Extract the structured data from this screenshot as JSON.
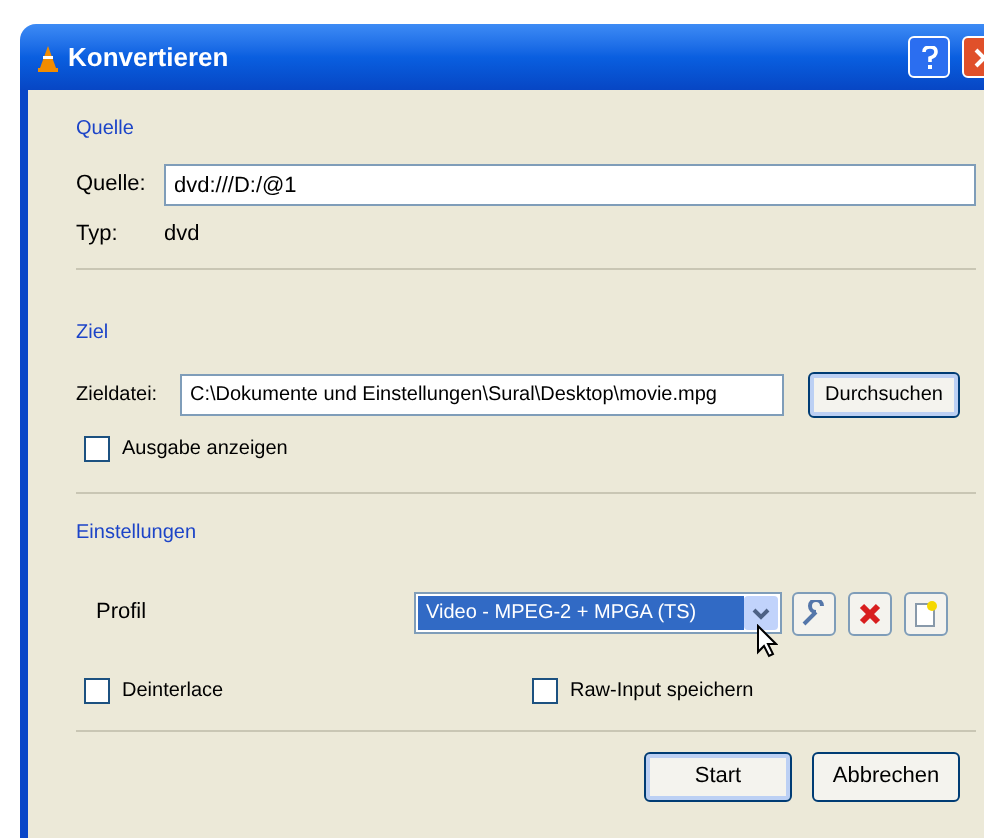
{
  "window": {
    "title": "Konvertieren"
  },
  "source": {
    "heading": "Quelle",
    "label": "Quelle:",
    "value": "dvd:///D:/@1",
    "type_label": "Typ:",
    "type_value": "dvd"
  },
  "target": {
    "heading": "Ziel",
    "label": "Zieldatei:",
    "value": "C:\\Dokumente und Einstellungen\\Sural\\Desktop\\movie.mpg",
    "browse": "Durchsuchen",
    "show_output": {
      "label": "Ausgabe anzeigen",
      "checked": false
    }
  },
  "settings": {
    "heading": "Einstellungen",
    "profile_label": "Profil",
    "profile": "Video - MPEG-2 + MPGA (TS)",
    "options": [
      {
        "label": "Deinterlace",
        "checked": false
      },
      {
        "label": "Raw-Input speichern",
        "checked": false
      }
    ]
  },
  "buttons": [
    "Start",
    "Abbrechen"
  ]
}
